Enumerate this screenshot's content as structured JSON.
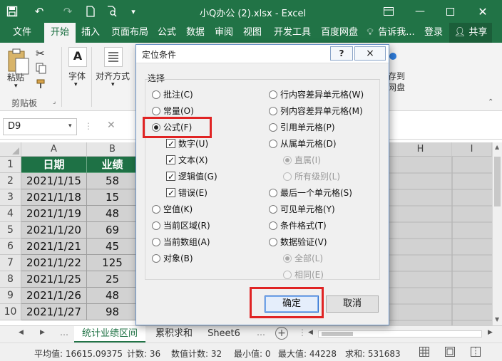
{
  "titlebar": {
    "title": "小Q办公 (2).xlsx - Excel",
    "save_icon": "save-icon",
    "undo_icon": "undo-icon",
    "redo_icon": "redo-icon",
    "new_icon": "new-file-icon",
    "preview_icon": "print-preview-icon"
  },
  "tabs": [
    "文件",
    "开始",
    "插入",
    "页面布局",
    "公式",
    "数据",
    "审阅",
    "视图",
    "开发工具",
    "百度网盘",
    "告诉我...",
    "登录",
    "共享"
  ],
  "ribbon": {
    "paste": "粘贴",
    "clipboard": "剪贴板",
    "font": "字体",
    "alignment": "对齐方式",
    "save_to_disk_1": "存到",
    "save_to_disk_2": "网盘"
  },
  "formulabar": {
    "namebox": "D9"
  },
  "grid": {
    "columns": [
      "A",
      "B",
      "H",
      "I"
    ],
    "rows": [
      "1",
      "2",
      "3",
      "4",
      "5",
      "6",
      "7",
      "8",
      "9",
      "10"
    ],
    "header": [
      "日期",
      "业绩"
    ],
    "data": [
      [
        "2021/1/15",
        "58"
      ],
      [
        "2021/1/18",
        "15"
      ],
      [
        "2021/1/19",
        "48"
      ],
      [
        "2021/1/20",
        "69"
      ],
      [
        "2021/1/21",
        "45"
      ],
      [
        "2021/1/22",
        "125"
      ],
      [
        "2021/1/25",
        "25"
      ],
      [
        "2021/1/26",
        "48"
      ],
      [
        "2021/1/27",
        "98"
      ]
    ]
  },
  "sheets": [
    "统计业绩区间",
    "累积求和",
    "Sheet6"
  ],
  "status": {
    "average": "平均值: 16615.09375",
    "count": "计数: 36",
    "numcount": "数值计数: 32",
    "min": "最小值: 0",
    "max": "最大值: 44228",
    "sum": "求和: 531683"
  },
  "dialog": {
    "title": "定位条件",
    "help": "?",
    "close": "×",
    "group_label": "选择",
    "left": {
      "comments": "批注(C)",
      "constants": "常量(O)",
      "formulas": "公式(F)",
      "numbers": "数字(U)",
      "text": "文本(X)",
      "logicals": "逻辑值(G)",
      "errors": "错误(E)",
      "blanks": "空值(K)",
      "current_region": "当前区域(R)",
      "current_array": "当前数组(A)",
      "objects": "对象(B)"
    },
    "right": {
      "row_diff": "行内容差异单元格(W)",
      "col_diff": "列内容差异单元格(M)",
      "precedents": "引用单元格(P)",
      "dependents": "从属单元格(D)",
      "direct": "直属(I)",
      "all_levels": "所有级别(L)",
      "last_cell": "最后一个单元格(S)",
      "visible": "可见单元格(Y)",
      "cond_format": "条件格式(T)",
      "data_validation": "数据验证(V)",
      "all": "全部(L)",
      "same": "相同(E)"
    },
    "ok": "确定",
    "cancel": "取消"
  }
}
